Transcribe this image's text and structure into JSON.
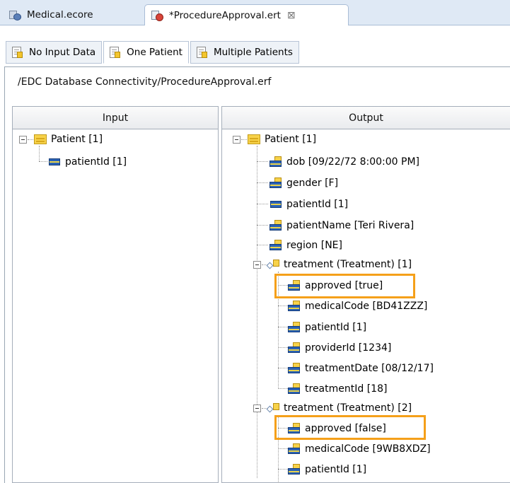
{
  "editor_tabs": [
    {
      "label": "Medical.ecore",
      "active": false
    },
    {
      "label": "*ProcedureApproval.ert",
      "active": true,
      "close": "⊠"
    }
  ],
  "sub_tabs": [
    {
      "label": "No Input Data",
      "selected": false
    },
    {
      "label": "One Patient",
      "selected": true
    },
    {
      "label": "Multiple Patients",
      "selected": false
    }
  ],
  "path": "/EDC Database Connectivity/ProcedureApproval.erf",
  "input_panel": {
    "header": "Input",
    "tree": [
      {
        "label": "Patient [1]"
      },
      {
        "label": "patientId [1]"
      }
    ]
  },
  "output_panel": {
    "header": "Output",
    "tree": [
      {
        "label": "Patient [1]"
      },
      {
        "label": "dob [09/22/72 8:00:00 PM]"
      },
      {
        "label": "gender [F]"
      },
      {
        "label": "patientId [1]"
      },
      {
        "label": "patientName [Teri Rivera]"
      },
      {
        "label": "region [NE]"
      },
      {
        "label": "treatment (Treatment) [1]"
      },
      {
        "label": "approved [true]",
        "highlighted": true
      },
      {
        "label": "medicalCode [BD41ZZZ]"
      },
      {
        "label": "patientId [1]"
      },
      {
        "label": "providerId [1234]"
      },
      {
        "label": "treatmentDate [08/12/17]"
      },
      {
        "label": "treatmentId [18]"
      },
      {
        "label": "treatment (Treatment) [2]"
      },
      {
        "label": "approved [false]",
        "highlighted": true
      },
      {
        "label": "medicalCode [9WB8XDZ]"
      },
      {
        "label": "patientId [1]"
      }
    ]
  },
  "colors": {
    "highlight": "#f5a01a",
    "tab_bar": "#dfe9f5"
  }
}
